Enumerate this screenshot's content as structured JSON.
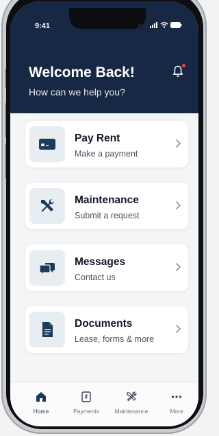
{
  "status_bar": {
    "time": "9:41"
  },
  "header": {
    "title": "Welcome Back!",
    "subtitle": "How can we help you?"
  },
  "cards": [
    {
      "title": "Pay Rent",
      "subtitle": "Make a payment",
      "icon": "credit-card-icon"
    },
    {
      "title": "Maintenance",
      "subtitle": "Submit a request",
      "icon": "tools-icon"
    },
    {
      "title": "Messages",
      "subtitle": "Contact us",
      "icon": "chat-bubbles-icon"
    },
    {
      "title": "Documents",
      "subtitle": "Lease, forms & more",
      "icon": "document-icon"
    }
  ],
  "nav": [
    {
      "label": "Home",
      "icon": "home-icon",
      "active": true
    },
    {
      "label": "Payments",
      "icon": "receipt-icon",
      "active": false
    },
    {
      "label": "Maintenance",
      "icon": "tools-icon",
      "active": false
    },
    {
      "label": "More",
      "icon": "more-icon",
      "active": false
    }
  ],
  "colors": {
    "header_bg": "#172844",
    "icon_color": "#1c3b5c",
    "card_icon_bg": "#e8edf1",
    "notification_dot": "#ff3b30"
  }
}
